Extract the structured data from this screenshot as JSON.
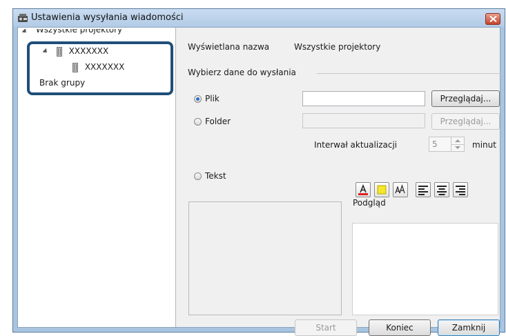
{
  "window": {
    "title": "Ustawienia wysyłania wiadomości"
  },
  "tree": {
    "root_label": "Wszystkie projektory",
    "group_label": "XXXXXXX",
    "child_label": "XXXXXXX",
    "no_group_label": "Brak grupy"
  },
  "form": {
    "display_name_label": "Wyświetlana nazwa",
    "display_name_value": "Wszystkie projektory",
    "section_label": "Wybierz dane do wysłania",
    "file_label": "Plik",
    "file_value": "",
    "folder_label": "Folder",
    "folder_value": "",
    "browse_label": "Przeglądaj...",
    "browse_folder_label": "Przeglądaj...",
    "interval_label": "Interwał aktualizacji",
    "interval_value": "5",
    "interval_unit": "minut",
    "text_label": "Tekst",
    "preview_label": "Podgląd",
    "selected_source": "Plik"
  },
  "buttons": {
    "start": "Start",
    "end": "Koniec",
    "close": "Zamknij"
  },
  "colors": {
    "highlight_border": "#1f4e79",
    "font_color_underline": "#e0201b",
    "background_color": "#f5e62c",
    "close_button": "#c4442c"
  },
  "icons": [
    "app-icon",
    "close-icon",
    "expand-arrow-icon",
    "projector-icon",
    "font-color-icon",
    "background-color-icon",
    "font-size-icon",
    "align-left-icon",
    "align-center-icon",
    "align-right-icon"
  ]
}
